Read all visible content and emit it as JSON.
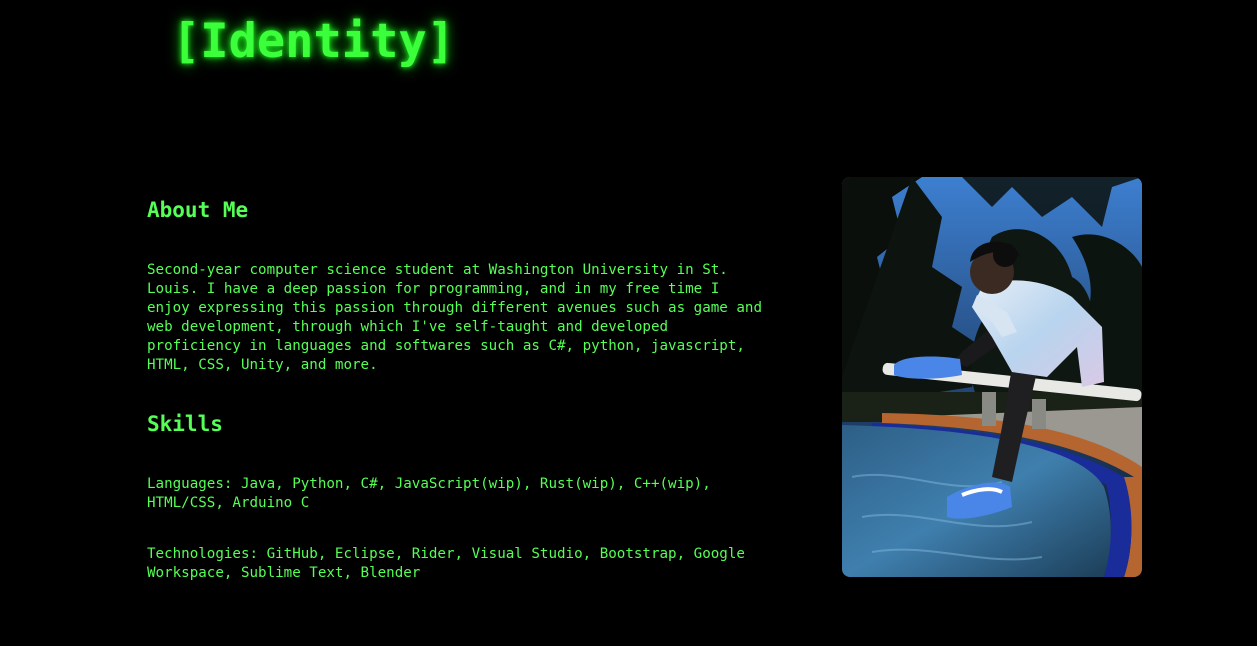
{
  "header": {
    "logo": "[Identity]"
  },
  "about": {
    "heading": "About Me",
    "text": "Second-year computer science student at Washington University in St.\nLouis. I have a deep passion for programming, and in my free time I\nenjoy expressing this passion through different avenues such as game and\nweb development, through which I've self-taught and developed\nproficiency in languages and softwares such as C#, python, javascript,\nHTML, CSS, Unity, and more."
  },
  "skills": {
    "heading": "Skills",
    "languages": "Languages: Java, Python, C#, JavaScript(wip), Rust(wip), C++(wip),\nHTML/CSS, Arduino C",
    "technologies": "Technologies: GitHub, Eclipse, Rider, Visual Studio, Bootstrap, Google\nWorkspace, Sublime Text, Blender"
  },
  "colors": {
    "background": "#000000",
    "accent": "#4cff4c"
  }
}
